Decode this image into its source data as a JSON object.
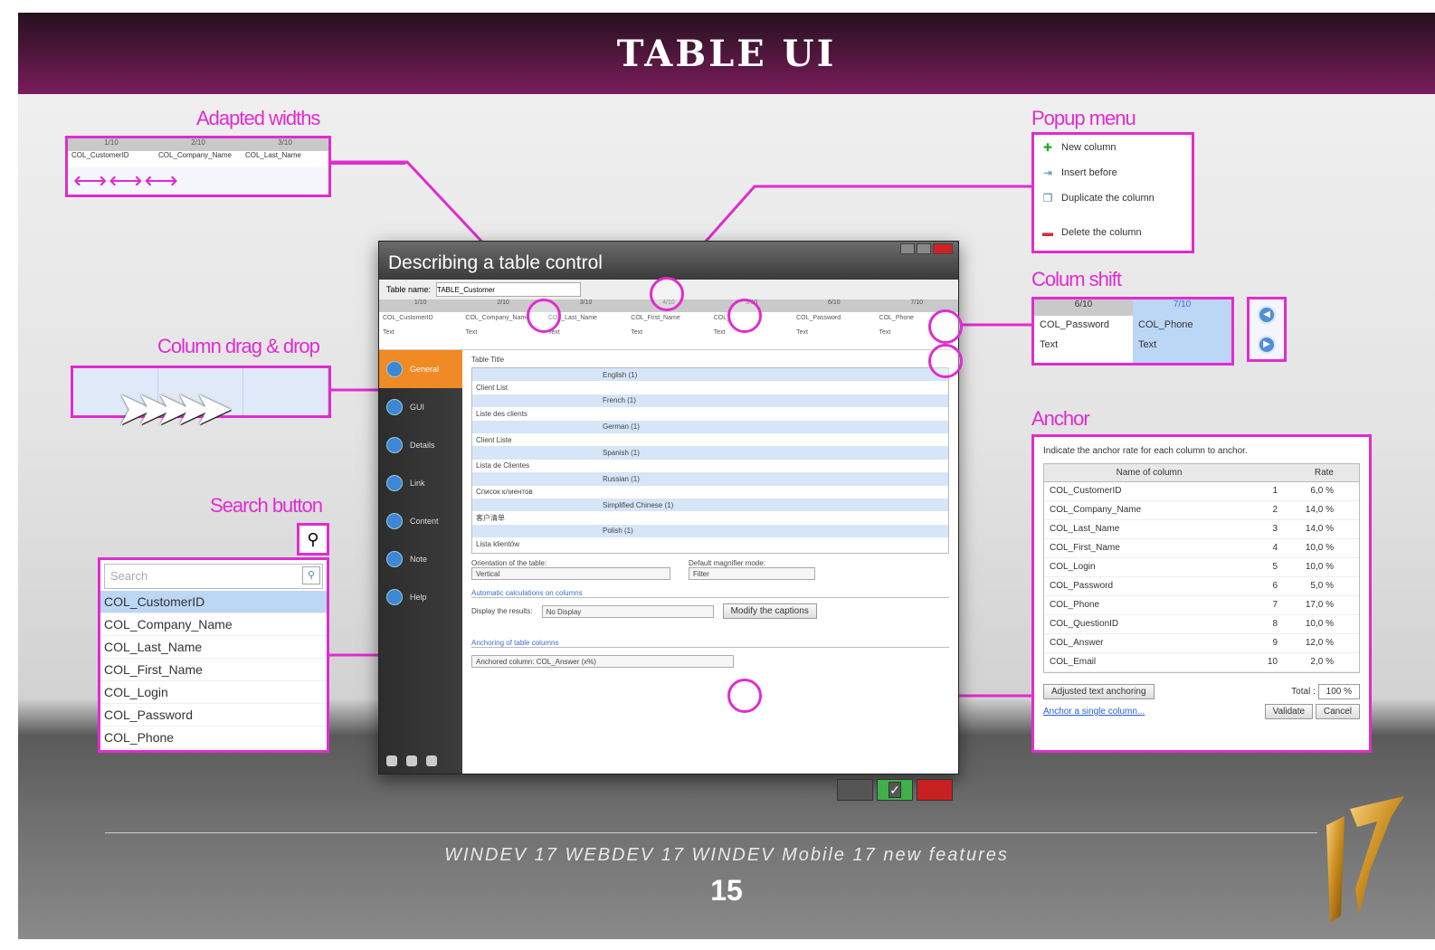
{
  "header": {
    "title": "TABLE UI"
  },
  "captions": {
    "adapted_widths": "Adapted widths",
    "popup_menu": "Popup menu",
    "column_shift": "Colum shift",
    "column_drag_drop": "Column drag & drop",
    "search_button": "Search button",
    "anchor": "Anchor"
  },
  "adapted_widths": {
    "headers": [
      "1/10",
      "2/10",
      "3/10"
    ],
    "columns": [
      "COL_CustomerID",
      "COL_Company_Name",
      "COL_Last_Name"
    ]
  },
  "popup_menu": {
    "items": [
      {
        "icon": "plus-icon",
        "label": "New column"
      },
      {
        "icon": "insert-icon",
        "label": "Insert before"
      },
      {
        "icon": "copy-icon",
        "label": "Duplicate the column"
      },
      {
        "icon": "minus-icon",
        "label": "Delete the column"
      }
    ]
  },
  "column_shift": {
    "left": {
      "header": "6/10",
      "name": "COL_Password",
      "type": "Text"
    },
    "right": {
      "header": "7/10",
      "name": "COL_Phone",
      "type": "Text"
    }
  },
  "search": {
    "placeholder": "Search",
    "items": [
      "COL_CustomerID",
      "COL_Company_Name",
      "COL_Last_Name",
      "COL_First_Name",
      "COL_Login",
      "COL_Password",
      "COL_Phone"
    ]
  },
  "anchor": {
    "intro": "Indicate the anchor rate for each column to anchor.",
    "headers": {
      "name": "Name of column",
      "rate": "Rate"
    },
    "rows": [
      {
        "name": "COL_CustomerID",
        "n": "1",
        "rate": "6,0 %"
      },
      {
        "name": "COL_Company_Name",
        "n": "2",
        "rate": "14,0 %"
      },
      {
        "name": "COL_Last_Name",
        "n": "3",
        "rate": "14,0 %"
      },
      {
        "name": "COL_First_Name",
        "n": "4",
        "rate": "10,0 %"
      },
      {
        "name": "COL_Login",
        "n": "5",
        "rate": "10,0 %"
      },
      {
        "name": "COL_Password",
        "n": "6",
        "rate": "5,0 %"
      },
      {
        "name": "COL_Phone",
        "n": "7",
        "rate": "17,0 %"
      },
      {
        "name": "COL_QuestionID",
        "n": "8",
        "rate": "10,0 %"
      },
      {
        "name": "COL_Answer",
        "n": "9",
        "rate": "12,0 %"
      },
      {
        "name": "COL_Email",
        "n": "10",
        "rate": "2,0 %"
      }
    ],
    "adjusted_button": "Adjusted text anchoring",
    "total_label": "Total :",
    "total_value": "100 %",
    "link": "Anchor a single column...",
    "validate": "Validate",
    "cancel": "Cancel"
  },
  "window": {
    "title": "Describing a table control",
    "table_name_label": "Table name:",
    "table_name_value": "TABLE_Customer",
    "col_headers": [
      "1/10",
      "2/10",
      "3/10",
      "4/10",
      "5/10",
      "6/10",
      "7/10"
    ],
    "col_names": [
      "COL_CustomerID",
      "COL_Company_Name",
      "COL_Last_Name",
      "COL_First_Name",
      "COL_...",
      "COL_Password",
      "COL_Phone"
    ],
    "col_types": [
      "Text",
      "Text",
      "Text",
      "Text",
      "Text",
      "Text",
      "Text"
    ],
    "side_items": [
      "General",
      "GUI",
      "Details",
      "Link",
      "Content",
      "Note",
      "Help"
    ],
    "table_title_label": "Table Title",
    "rows": [
      {
        "text": "",
        "lang": "English (1)"
      },
      {
        "text": "Client List",
        "lang": ""
      },
      {
        "text": "",
        "lang": "French (1)"
      },
      {
        "text": "Liste des clients",
        "lang": ""
      },
      {
        "text": "",
        "lang": "German (1)"
      },
      {
        "text": "Client Liste",
        "lang": ""
      },
      {
        "text": "",
        "lang": "Spanish (1)"
      },
      {
        "text": "Lista de Clientes",
        "lang": ""
      },
      {
        "text": "",
        "lang": "Russian (1)"
      },
      {
        "text": "Список клиентов",
        "lang": ""
      },
      {
        "text": "",
        "lang": "Simplified Chinese (1)"
      },
      {
        "text": "客户清单",
        "lang": ""
      },
      {
        "text": "",
        "lang": "Polish (1)"
      },
      {
        "text": "Lista klientów",
        "lang": ""
      }
    ],
    "orientation_label": "Orientation of the table:",
    "orientation_value": "Vertical",
    "magnifier_label": "Default magnifier mode:",
    "magnifier_value": "Filter",
    "auto_calc_section": "Automatic calculations on columns",
    "display_results_label": "Display the results:",
    "display_results_value": "No Display",
    "modify_captions": "Modify the captions",
    "anchoring_section": "Anchoring of table columns",
    "anchoring_value": "Anchored column: COL_Answer (x%)"
  },
  "footer": {
    "text": "WINDEV 17   WEBDEV 17   WINDEV Mobile 17 new features",
    "page": "15"
  },
  "colors": {
    "accent": "#e02cd0",
    "header": "#7b1c5c",
    "selection": "#bcd6f5"
  }
}
